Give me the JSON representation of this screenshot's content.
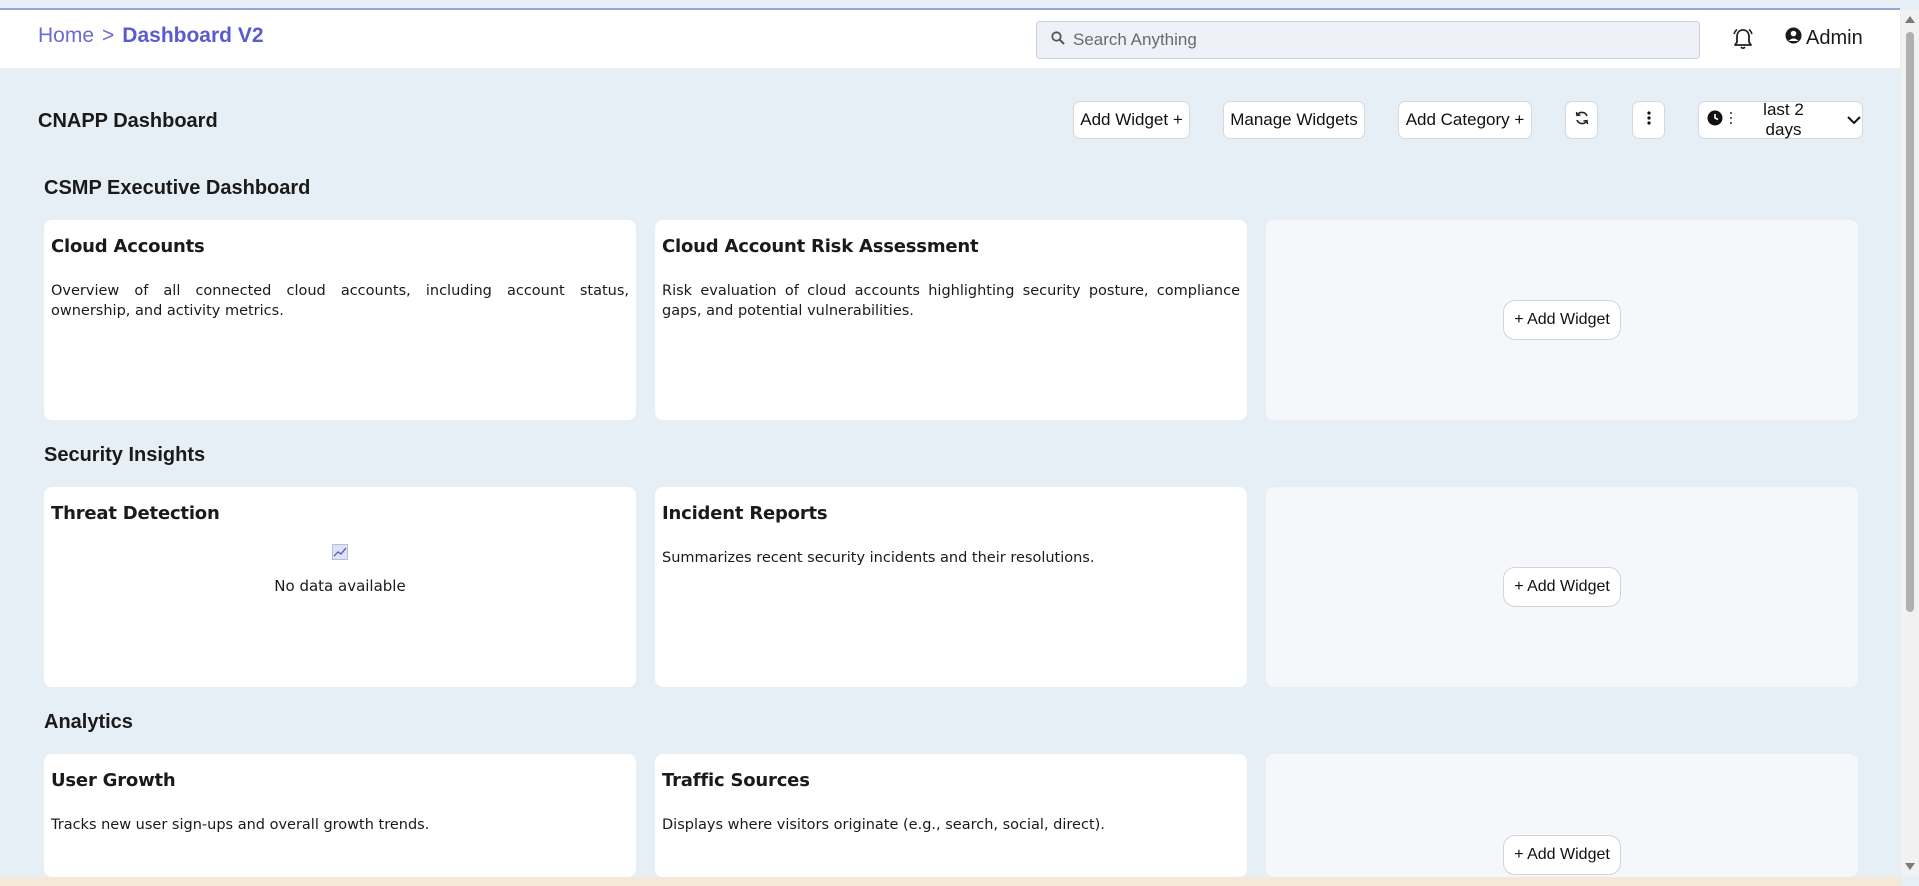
{
  "header": {
    "breadcrumb": {
      "home": "Home",
      "separator": ">",
      "current": "Dashboard V2"
    },
    "search": {
      "placeholder": "Search Anything",
      "value": ""
    },
    "notifications_icon": "bell-icon",
    "user": {
      "label": "Admin",
      "icon": "user-circle-icon"
    }
  },
  "dashboard": {
    "title": "CNAPP Dashboard",
    "toolbar": {
      "add_widget": "Add Widget +",
      "manage_widgets": "Manage Widgets",
      "add_category": "Add Category +",
      "refresh_icon": "refresh-icon",
      "more_icon": "more-vertical-icon",
      "time_range": "last 2 days",
      "time_icon": "clock-icon"
    }
  },
  "categories": [
    {
      "title": "CSMP Executive Dashboard",
      "widgets": [
        {
          "title": "Cloud Accounts",
          "text": "Overview of all connected cloud accounts, including account status, ownership, and activity metrics."
        },
        {
          "title": "Cloud Account Risk Assessment",
          "text": "Risk evaluation of cloud accounts highlighting security posture, compliance gaps, and potential vulnerabilities."
        }
      ],
      "add_label": "+ Add Widget"
    },
    {
      "title": "Security Insights",
      "widgets": [
        {
          "title": "Threat Detection",
          "nodata": "No data available"
        },
        {
          "title": "Incident Reports",
          "text": "Summarizes recent security incidents and their resolutions."
        }
      ],
      "add_label": "+ Add Widget"
    },
    {
      "title": "Analytics",
      "widgets": [
        {
          "title": "User Growth",
          "text": "Tracks new user sign-ups and overall growth trends."
        },
        {
          "title": "Traffic Sources",
          "text": "Displays where visitors originate (e.g., search, social, direct)."
        }
      ],
      "add_label": "+ Add Widget"
    }
  ],
  "colors": {
    "accent": "#5b5bd1",
    "page_bg": "#e6eef6",
    "card_bg": "#ffffff",
    "empty_card_bg": "#f5f7fa"
  }
}
